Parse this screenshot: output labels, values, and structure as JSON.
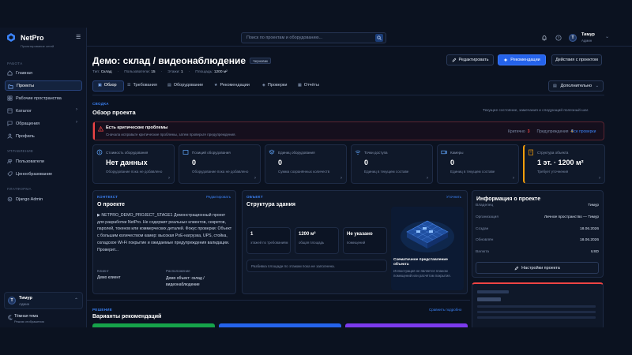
{
  "app": {
    "name": "NetPro",
    "subtitle": "Проектирование сетей"
  },
  "sidebar": {
    "sections": [
      {
        "title": "РАБОТА",
        "items": [
          {
            "label": "Главная",
            "icon": "home-icon"
          },
          {
            "label": "Проекты",
            "icon": "folder-icon",
            "active": true
          },
          {
            "label": "Рабочие пространства",
            "icon": "grid-icon"
          },
          {
            "label": "Каталог",
            "icon": "catalog-icon",
            "caret": "›"
          },
          {
            "label": "Обращения",
            "icon": "chat-icon",
            "caret": "›"
          },
          {
            "label": "Профиль",
            "icon": "user-icon"
          }
        ]
      },
      {
        "title": "УПРАВЛЕНИЕ",
        "items": [
          {
            "label": "Пользователи",
            "icon": "users-icon"
          },
          {
            "label": "Ценообразование",
            "icon": "price-icon"
          }
        ]
      },
      {
        "title": "ПЛАТФОРМА",
        "items": [
          {
            "label": "Django Admin",
            "icon": "admin-icon"
          }
        ]
      }
    ],
    "user": {
      "initial": "Т",
      "name": "Тимур",
      "role": "Админ",
      "caret": "⌃"
    },
    "theme": {
      "label": "Тёмная тема",
      "sub": "Режим отображения"
    }
  },
  "topbar": {
    "search_placeholder": "Поиск по проектам и оборудованию...",
    "user": {
      "initial": "Т",
      "name": "Тимур",
      "role": "Админ",
      "caret": "⌄"
    }
  },
  "project": {
    "title": "Демо: склад / видеонаблюдение",
    "badge": "Черновик",
    "meta": [
      {
        "k": "Тип:",
        "v": "Склад"
      },
      {
        "k": "Пользователи:",
        "v": "15"
      },
      {
        "k": "Этажи:",
        "v": "1"
      },
      {
        "k": "Площадь:",
        "v": "1200 м²"
      }
    ],
    "actions": {
      "edit": "Редактировать",
      "recommend": "Рекомендации",
      "actions": "Действия с проектом"
    }
  },
  "tabs": [
    {
      "label": "Обзор",
      "icon": "overview-icon",
      "active": true
    },
    {
      "label": "Требования",
      "icon": "list-icon"
    },
    {
      "label": "Оборудование",
      "icon": "device-icon"
    },
    {
      "label": "Рекомендации",
      "icon": "star-icon"
    },
    {
      "label": "Проверки",
      "icon": "shield-icon"
    },
    {
      "label": "Отчёты",
      "icon": "report-icon"
    }
  ],
  "more_tab": "Дополнительно",
  "summary": {
    "section": "СВОДКА",
    "title": "Обзор проекта",
    "hint": "Текущее состояние, замечания и следующий полезный шаг."
  },
  "alert": {
    "title": "Есть критические проблемы",
    "text": "Сначала исправьте критические проблемы, затем проверьте предупреждения.",
    "critical_label": "Критично",
    "critical_count": "3",
    "warn_label": "Предупреждения",
    "warn_count": "4",
    "link": "Все проверки"
  },
  "stats": [
    {
      "label": "Стоимость оборудования",
      "value": "Нет данных",
      "sub": "Оборудование пока не добавлено",
      "icon": "money-icon"
    },
    {
      "label": "Позиций оборудования",
      "value": "0",
      "sub": "Оборудование пока не добавлено",
      "icon": "box-icon"
    },
    {
      "label": "Единиц оборудования",
      "value": "0",
      "sub": "Сумма сохранённых количеств",
      "icon": "layers-icon"
    },
    {
      "label": "Точки доступа",
      "value": "0",
      "sub": "Единиц в текущем составе",
      "icon": "wifi-icon"
    },
    {
      "label": "Камеры",
      "value": "0",
      "sub": "Единиц в текущем составе",
      "icon": "camera-icon"
    },
    {
      "label": "Структура объекта",
      "value": "1 эт. · 1200 м²",
      "sub": "Требует уточнения",
      "icon": "building-icon"
    }
  ],
  "context": {
    "section": "КОНТЕКСТ",
    "link": "Редактировать",
    "title": "О проекте",
    "text": "▶ NETPRO_DEMO_PROJECT_STAGE1 Демонстрационный проект для разработки NetPro. Не содержит реальных клиентов, секретов, паролей, токенов или коммерческих деталей. Фокус проверки: Объект с большим количеством камер: высокая PoE-нагрузка, UPS, стойка, складское Wi-Fi покрытие и ожидаемые предупреждения валидации. Проверит...",
    "client_label": "Клиент",
    "client": "Демо клиент",
    "location_label": "Расположение",
    "location": "Демо объект: склад / видеонаблюдение"
  },
  "structure": {
    "section": "ОБЪЕКТ",
    "link": "Уточнить",
    "title": "Структура здания",
    "metrics": [
      {
        "value": "1",
        "label": "этажей по требованиям"
      },
      {
        "value": "1200 м²",
        "label": "общая площадь"
      },
      {
        "value": "Не указано",
        "label": "помещений"
      }
    ],
    "note": "Разбивка площади по этажам пока не заполнена.",
    "image_caption": "Схематичное представление объекта",
    "image_sub": "Иллюстрация не является планом помещений или расчётом покрытия."
  },
  "info": {
    "title": "Информация о проекте",
    "rows": [
      {
        "k": "Владелец",
        "v": "Тимур"
      },
      {
        "k": "Организация",
        "v": "Личное пространство — Тимур"
      },
      {
        "k": "Создан",
        "v": "18.06.2026"
      },
      {
        "k": "Обновлён",
        "v": "18.06.2026"
      },
      {
        "k": "Валюта",
        "v": "USD"
      }
    ],
    "button": "Настройки проекта"
  },
  "recommendations": {
    "section": "РЕШЕНИЕ",
    "link": "Сравнить подробно",
    "title": "Варианты рекомендаций"
  }
}
